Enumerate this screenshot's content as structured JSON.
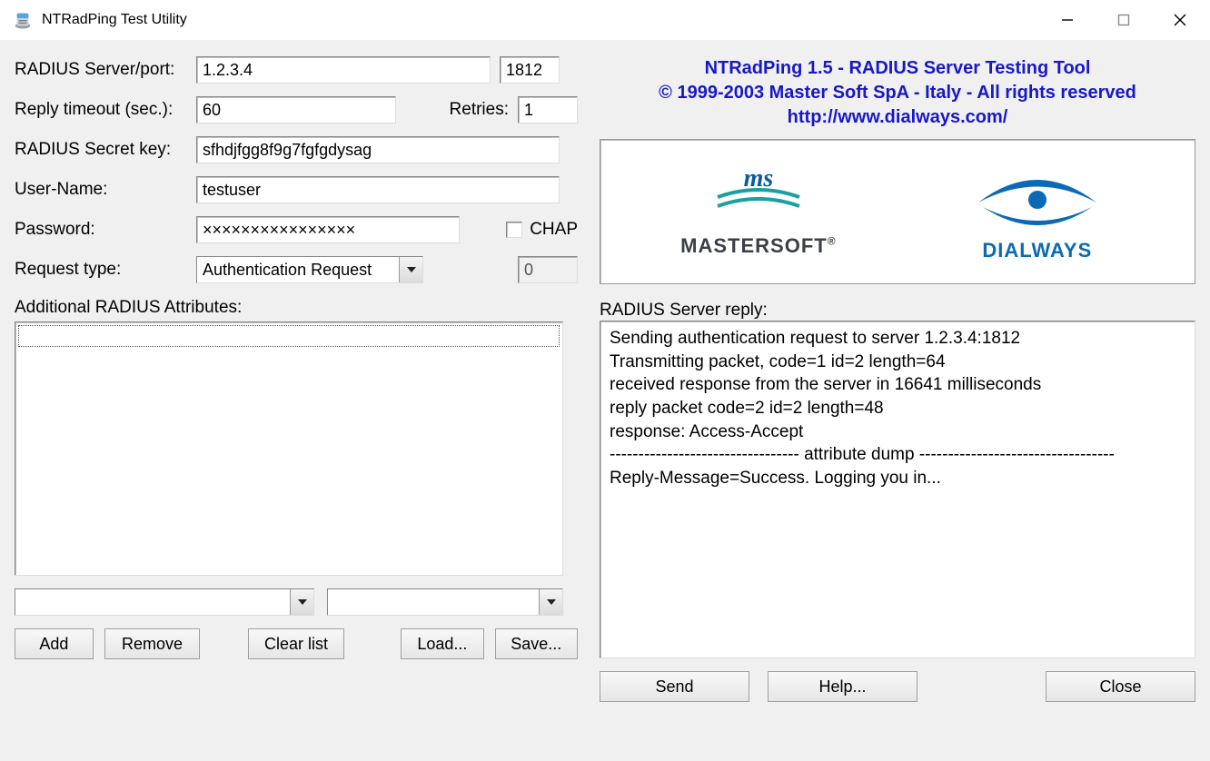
{
  "window": {
    "title": "NTRadPing Test Utility"
  },
  "labels": {
    "server": "RADIUS Server/port:",
    "timeout": "Reply timeout (sec.):",
    "retries": "Retries:",
    "secret": "RADIUS Secret key:",
    "user": "User-Name:",
    "password": "Password:",
    "chap": "CHAP",
    "reqtype": "Request type:",
    "attrs": "Additional RADIUS Attributes:",
    "replyhdr": "RADIUS Server reply:"
  },
  "fields": {
    "server": "1.2.3.4",
    "port": "1812",
    "timeout": "60",
    "retries": "1",
    "secret": "sfhdjfgg8f9g7fgfgdysag",
    "user": "testuser",
    "password": "××××××××××××××××",
    "chap_checked": false,
    "reqtype": "Authentication Request",
    "reqnum": "0"
  },
  "buttons": {
    "add": "Add",
    "remove": "Remove",
    "clear": "Clear list",
    "load": "Load...",
    "save": "Save...",
    "send": "Send",
    "help": "Help...",
    "close": "Close"
  },
  "banner": {
    "l1": "NTRadPing 1.5 - RADIUS Server Testing Tool",
    "l2": "© 1999-2003 Master Soft SpA - Italy - All rights reserved",
    "l3": "http://www.dialways.com/"
  },
  "logos": {
    "left": "MASTERSOFT",
    "right": "DIALWAYS"
  },
  "reply_lines": [
    "Sending authentication request to server 1.2.3.4:1812",
    "Transmitting packet, code=1 id=2 length=64",
    "received response from the server in 16641 milliseconds",
    "reply packet code=2 id=2 length=48",
    "response: Access-Accept",
    "--------------------------------- attribute dump ----------------------------------",
    "Reply-Message=Success. Logging you in..."
  ]
}
